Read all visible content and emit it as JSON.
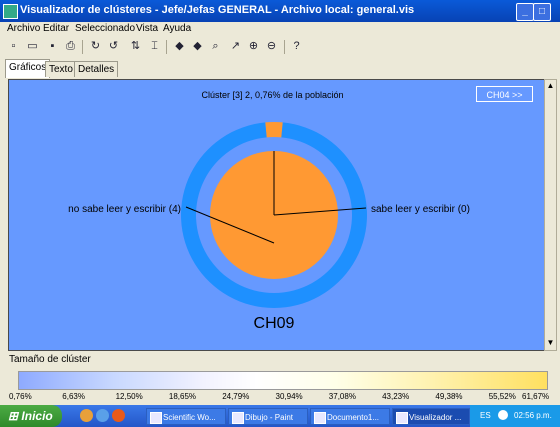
{
  "window": {
    "title": "Visualizador de clústeres - Jefe/Jefas GENERAL - Archivo local: general.vis"
  },
  "menu": [
    "Archivo",
    "Editar",
    "Seleccionado",
    "Vista",
    "Ayuda"
  ],
  "tabs": [
    "Gráficos",
    "Texto",
    "Detalles"
  ],
  "chart": {
    "cluster_label": "Clúster [3] 2, 0,76% de la población",
    "next_button": "CH04 >>",
    "label_left": "no sabe leer y escribir (4)",
    "label_right": "sabe leer y escribir (0)",
    "variable_name": "CH09"
  },
  "chart_data": {
    "type": "pie",
    "title": "CH09",
    "inner_pie": {
      "categories": [
        "no sabe leer y escribir (4)",
        "sabe leer y escribir (0)"
      ],
      "values": [
        100,
        0
      ]
    },
    "outer_ring": {
      "categories": [
        "no sabe leer y escribir (4)",
        "sabe leer y escribir (0)"
      ],
      "values": [
        3,
        97
      ]
    }
  },
  "size_scale": {
    "label": "Tamaño de clúster",
    "ticks": [
      "0,76%",
      "6,63%",
      "12,50%",
      "18,65%",
      "24,79%",
      "30,94%",
      "37,08%",
      "43,23%",
      "49,38%",
      "55,52%",
      "61,67%"
    ]
  },
  "taskbar": {
    "start": "Inicio",
    "tasks": [
      "Scientific Wo...",
      "Dibujo - Paint",
      "Documento1...",
      "Visualizador ..."
    ],
    "lang": "ES",
    "clock": "02:56 p.m."
  },
  "colors": {
    "canvas": "#6699ff",
    "pie": "#ff9933",
    "ring": "#1e90ff"
  }
}
